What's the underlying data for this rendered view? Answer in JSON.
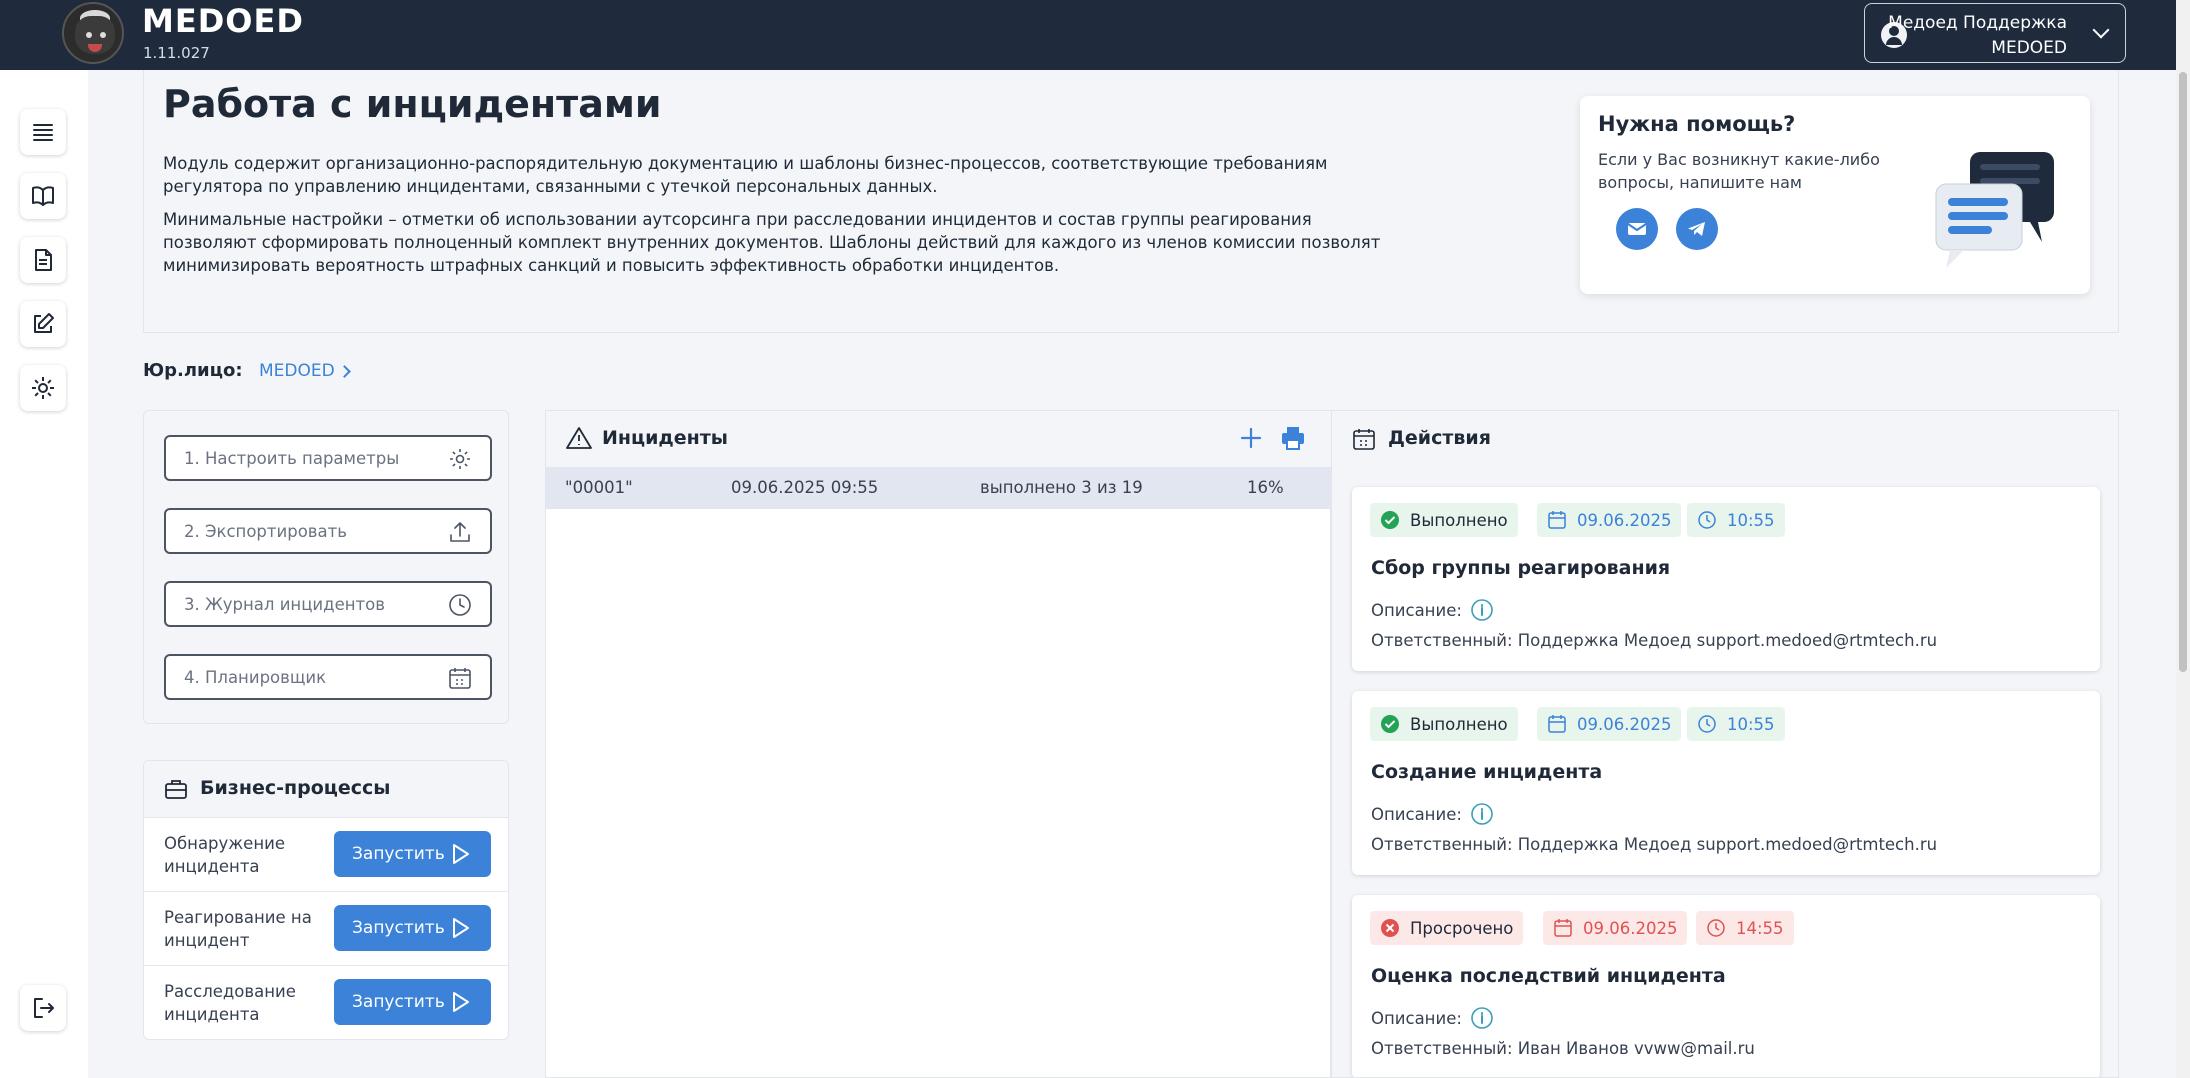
{
  "app": {
    "title": "MEDOED",
    "version": "1.11.027"
  },
  "user": {
    "name": "Медоед Поддержка",
    "org": "MEDOED"
  },
  "sidebar": {
    "items": [
      "menu-icon",
      "book-icon",
      "document-icon",
      "edit-icon",
      "gear-icon",
      "logout-icon"
    ]
  },
  "page": {
    "title": "Работа с инцидентами",
    "para1": "Модуль содержит организационно-распорядительную документацию и шаблоны бизнес-процессов, соответствующие требованиям регулятора по управлению инцидентами, связанными с утечкой персональных данных.",
    "para2": "Минимальные настройки – отметки об использовании аутсорсинга при расследовании инцидентов и состав группы реагирования позволяют сформировать полноценный комплект внутренних документов. Шаблоны действий для каждого из членов комиссии позволят минимизировать вероятность штрафных санкций и повысить эффективность обработки инцидентов."
  },
  "help": {
    "title": "Нужна помощь?",
    "text": "Если у Вас возникнут какие-либо вопросы, напишите нам"
  },
  "entity": {
    "label": "Юр.лицо:",
    "value": "MEDOED"
  },
  "steps": [
    {
      "label": "1. Настроить параметры",
      "icon": "gear-icon"
    },
    {
      "label": "2. Экспортировать",
      "icon": "upload-icon"
    },
    {
      "label": "3. Журнал инцидентов",
      "icon": "clock-icon"
    },
    {
      "label": "4. Планировщик",
      "icon": "calendar-icon"
    }
  ],
  "business": {
    "title": "Бизнес-процессы",
    "run_label": "Запустить",
    "items": [
      {
        "name": "Обнаружение инцидента"
      },
      {
        "name": "Реагирование на инцидент"
      },
      {
        "name": "Расследование инцидента"
      }
    ]
  },
  "incidents": {
    "title": "Инциденты",
    "rows": [
      {
        "id": "\"00001\"",
        "datetime": "09.06.2025 09:55",
        "progress_text": "выполнено 3 из 19",
        "percent": "16%"
      }
    ]
  },
  "actions": {
    "title": "Действия",
    "desc_label": "Описание:",
    "items": [
      {
        "status": "Выполнено",
        "status_type": "ok",
        "date": "09.06.2025",
        "time": "10:55",
        "name": "Сбор группы реагирования",
        "responsible": "Ответственный: Поддержка Медоед support.medoed@rtmtech.ru"
      },
      {
        "status": "Выполнено",
        "status_type": "ok",
        "date": "09.06.2025",
        "time": "10:55",
        "name": "Создание инцидента",
        "responsible": "Ответственный: Поддержка Медоед support.medoed@rtmtech.ru"
      },
      {
        "status": "Просрочено",
        "status_type": "bad",
        "date": "09.06.2025",
        "time": "14:55",
        "name": "Оценка последствий инцидента",
        "responsible": "Ответственный: Иван Иванов vvww@mail.ru"
      }
    ]
  },
  "colors": {
    "topbar": "#1f2b3d",
    "accent": "#3b82d8",
    "ok": "#22a355",
    "bad": "#e05252"
  }
}
